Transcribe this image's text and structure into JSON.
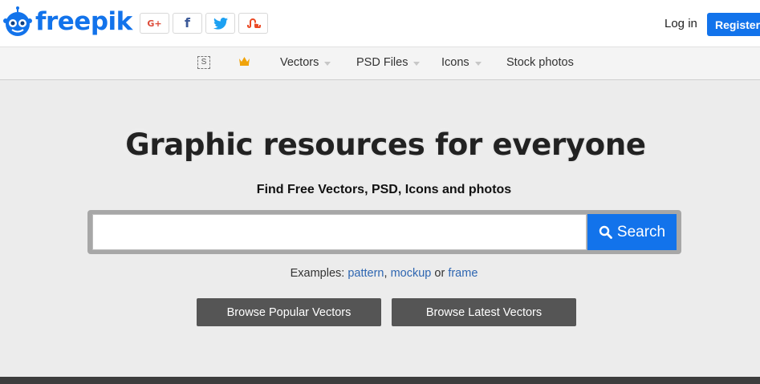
{
  "brand": {
    "name": "freepik",
    "color": "#1273eb"
  },
  "social": [
    {
      "name": "google-plus",
      "glyph": "G+",
      "color": "#dd4b39"
    },
    {
      "name": "facebook",
      "glyph": "f",
      "color": "#3b5998"
    },
    {
      "name": "twitter",
      "glyph": "twitter-bird",
      "color": "#1da1f2"
    },
    {
      "name": "stumbleupon",
      "glyph": "su",
      "color": "#eb4924"
    }
  ],
  "header": {
    "login_label": "Log in",
    "register_label": "Register"
  },
  "nav": {
    "items": [
      {
        "label": "Vectors",
        "has_dropdown": true
      },
      {
        "label": "PSD Files",
        "has_dropdown": true
      },
      {
        "label": "Icons",
        "has_dropdown": true
      },
      {
        "label": "Stock photos",
        "has_dropdown": false
      }
    ],
    "s_icon_label": "S"
  },
  "hero": {
    "title": "Graphic resources for everyone",
    "subtitle": "Find Free Vectors, PSD, Icons and photos"
  },
  "search": {
    "value": "",
    "placeholder": "",
    "button_label": "Search"
  },
  "examples": {
    "prefix": "Examples:",
    "links": [
      "pattern",
      "mockup",
      "frame"
    ],
    "sep_comma": ",",
    "sep_or": "or"
  },
  "browse": {
    "popular_label": "Browse Popular Vectors",
    "latest_label": "Browse Latest Vectors"
  }
}
